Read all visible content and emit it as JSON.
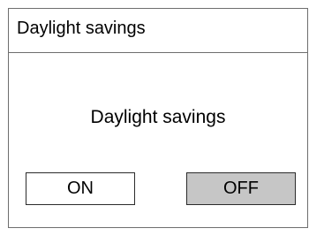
{
  "dialog": {
    "title": "Daylight savings",
    "heading": "Daylight savings",
    "options": [
      {
        "label": "ON",
        "selected": false
      },
      {
        "label": "OFF",
        "selected": true
      }
    ]
  },
  "colors": {
    "border": "#6e6e6e",
    "selected_background": "#c6c6c6",
    "unselected_background": "#ffffff"
  }
}
